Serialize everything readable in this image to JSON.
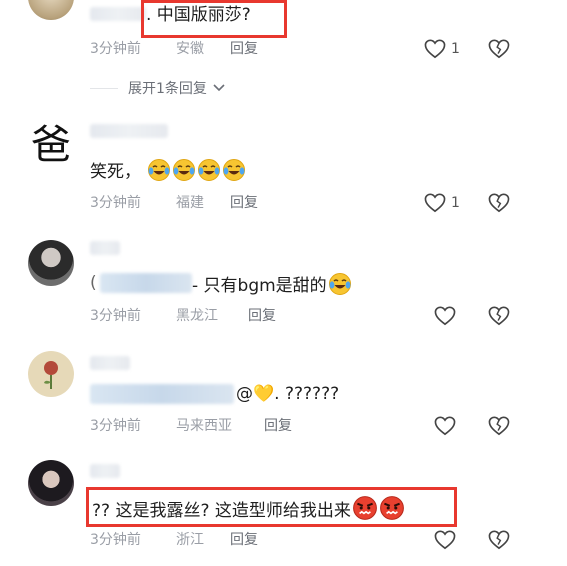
{
  "comments": [
    {
      "text": ". 中国版丽莎?",
      "time": "3分钟前",
      "location": "安徽",
      "reply": "回复",
      "likes": "1"
    },
    {
      "avatar_char": "爸",
      "text": "笑死，",
      "time": "3分钟前",
      "location": "福建",
      "reply": "回复",
      "likes": "1"
    },
    {
      "text_prefix": "(",
      "text": "- 只有bgm是甜的",
      "time": "3分钟前",
      "location": "黑龙江",
      "reply": "回复"
    },
    {
      "text": "@💛. ??????",
      "time": "3分钟前",
      "location": "马来西亚",
      "reply": "回复"
    },
    {
      "text": "?? 这是我露丝? 这造型师给我出来",
      "time": "3分钟前",
      "location": "浙江",
      "reply": "回复"
    }
  ],
  "expand_replies": "展开1条回复",
  "icons": {
    "like": "heart-outline-icon",
    "dislike": "broken-heart-icon",
    "chevron": "chevron-down-icon",
    "laugh": "laughing-tears-emoji",
    "angry": "angry-face-emoji"
  },
  "colors": {
    "highlight": "#e8382f",
    "meta": "#9a9ea6",
    "text": "#1e1e1e"
  }
}
